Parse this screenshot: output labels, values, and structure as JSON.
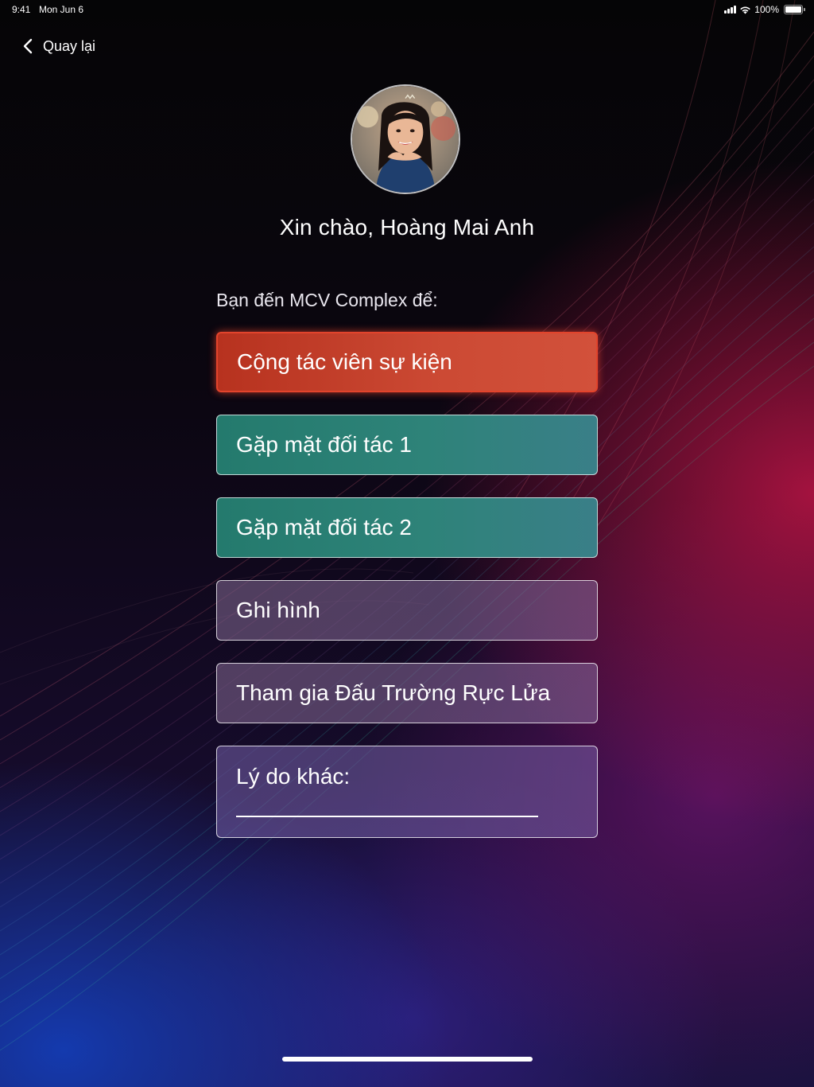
{
  "status_bar": {
    "time": "9:41",
    "date": "Mon Jun 6",
    "battery": "100%"
  },
  "nav": {
    "back_label": "Quay lại"
  },
  "profile": {
    "greeting": "Xin chào, Hoàng Mai Anh"
  },
  "form": {
    "prompt": "Bạn đến MCV Complex để:",
    "options": [
      {
        "label": "Cộng tác viên sự kiện",
        "selected": true
      },
      {
        "label": "Gặp mặt đối tác 1",
        "selected": false
      },
      {
        "label": "Gặp mặt đối tác 2",
        "selected": false
      },
      {
        "label": "Ghi hình",
        "selected": false
      },
      {
        "label": "Tham gia Đấu Trường Rực Lửa",
        "selected": false
      }
    ],
    "other": {
      "label": "Lý do khác:",
      "value": ""
    }
  },
  "colors": {
    "selected": "#cc4a34",
    "teal": "#2e8379",
    "purple": "#7d6496"
  }
}
